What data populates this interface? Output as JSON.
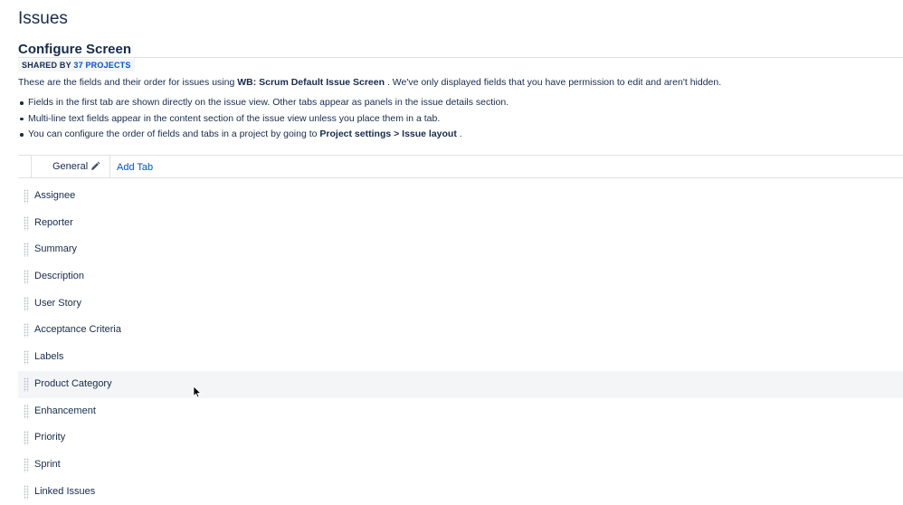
{
  "header": {
    "title": "Issues",
    "subtitle": "Configure Screen",
    "shared_prefix": "SHARED BY",
    "shared_count": "37 PROJECTS"
  },
  "description": {
    "prefix": "These are the fields and their order for issues using",
    "screen_name": "WB: Scrum Default Issue Screen",
    "suffix": ". We've only displayed fields that you have permission to edit and aren't hidden."
  },
  "bullets": [
    {
      "text": "Fields in the first tab are shown directly on the issue view. Other tabs appear as panels in the issue details section."
    },
    {
      "text": "Multi-line text fields appear in the content section of the issue view unless you place them in a tab."
    },
    {
      "prefix": "You can configure the order of fields and tabs in a project by going to",
      "bold": "Project settings > Issue layout",
      "suffix": "."
    }
  ],
  "tabs": {
    "general_label": "General",
    "add_label": "Add Tab"
  },
  "fields": [
    "Assignee",
    "Reporter",
    "Summary",
    "Description",
    "User Story",
    "Acceptance Criteria",
    "Labels",
    "Product Category",
    "Enhancement",
    "Priority",
    "Sprint",
    "Linked Issues"
  ],
  "colors": {
    "text": "#172b4d",
    "link": "#0052cc",
    "border": "#dfe1e6",
    "hover_row": "#f4f5f7"
  }
}
